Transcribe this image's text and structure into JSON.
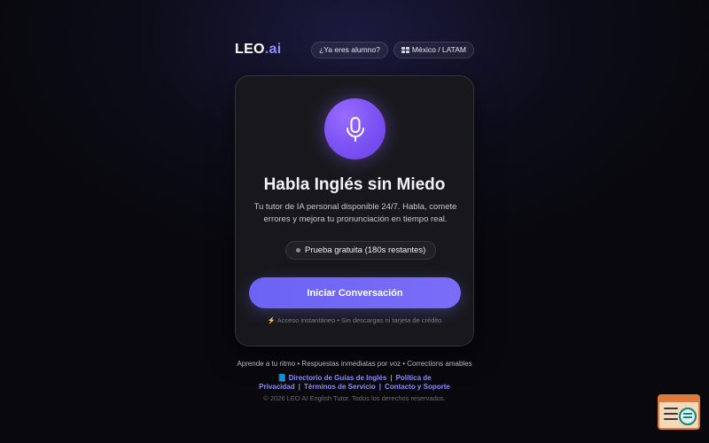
{
  "header": {
    "logo_main": "LEO",
    "logo_dot": ".",
    "logo_suffix": "ai",
    "student_button": "¿Ya eres alumno?",
    "region_button": "México / LATAM"
  },
  "card": {
    "title": "Habla Inglés sin Miedo",
    "description": "Tu tutor de IA personal disponible 24/7. Habla, comete errores y mejora tu pronunciación en tiempo real.",
    "trial_badge": "Prueba gratuita (180s restantes)",
    "cta": "Iniciar Conversación",
    "note": "⚡ Acceso instantáneo • Sin descargas ni tarjeta de crédito"
  },
  "footer": {
    "features": "Aprende a tu ritmo • Respuestas inmediatas por voz • Corrections amables",
    "links": [
      "📘 Directorio de Guías de Inglés",
      "Política de Privacidad",
      "Términos de Servicio",
      "Contacto y Soporte"
    ],
    "separator": "|",
    "copyright": "© 2026 LEO AI English Tutor. Todos los derechos reservados."
  },
  "colors": {
    "accent": "#6b63f4",
    "mic_gradient_start": "#9a6cff",
    "link": "#8b8bff"
  },
  "icons": {
    "mic": "microphone-icon",
    "region": "grid-flag-icon",
    "widget": "search-document-icon"
  }
}
